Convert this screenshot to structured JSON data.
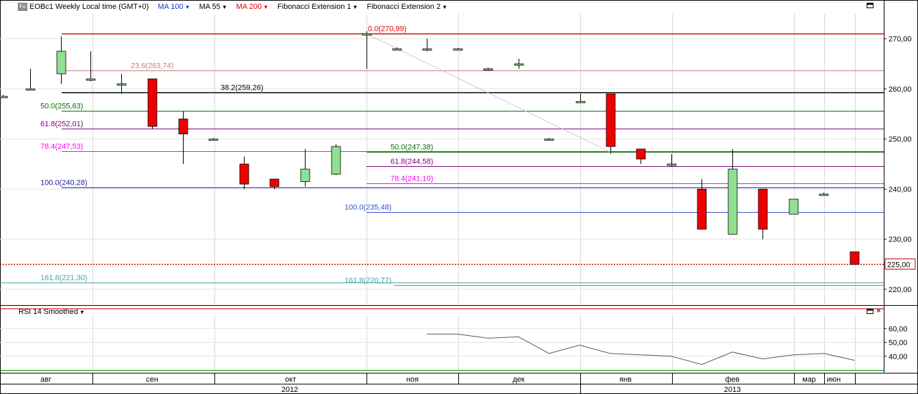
{
  "header": {
    "symbol_badge": "Fu",
    "symbol": "EOBc1 Weekly Local time (GMT+0)",
    "indicators": [
      {
        "label": "MA 100",
        "color": "#1e32c8"
      },
      {
        "label": "MA 55",
        "color": "#000000"
      },
      {
        "label": "MA 200",
        "color": "#e00000"
      },
      {
        "label": "Fibonacci Extension 1",
        "color": "#000000"
      },
      {
        "label": "Fibonacci Extension 2",
        "color": "#000000"
      }
    ]
  },
  "rsi_panel": {
    "title": "RSI 14 Smoothed"
  },
  "chart_data": [
    {
      "type": "candlestick",
      "ylim": [
        217,
        275
      ],
      "y_ticks": [
        "270,00",
        "260,00",
        "250,00",
        "240,00",
        "230,00",
        "220,00"
      ],
      "y_tick_values": [
        270,
        260,
        250,
        240,
        230,
        220
      ],
      "last_price_label": "225,00",
      "last_price": 225.0,
      "x_labels_months": [
        "авг",
        "сен",
        "окт",
        "ноя",
        "дек",
        "янв",
        "фев",
        "мар",
        "июн"
      ],
      "x_labels_years": [
        "2012",
        "2013"
      ],
      "candles": [
        {
          "o": 258.5,
          "h": 258.8,
          "l": 258.2,
          "c": 258.5
        },
        {
          "o": 260.0,
          "h": 264.0,
          "l": 259.8,
          "c": 260.0
        },
        {
          "o": 263.0,
          "h": 270.5,
          "l": 261.0,
          "c": 267.5
        },
        {
          "o": 262.0,
          "h": 267.5,
          "l": 261.5,
          "c": 262.0
        },
        {
          "o": 261.0,
          "h": 263.0,
          "l": 259.0,
          "c": 261.0
        },
        {
          "o": 262.0,
          "h": 262.0,
          "l": 252.0,
          "c": 252.5
        },
        {
          "o": 254.0,
          "h": 255.5,
          "l": 245.0,
          "c": 251.0
        },
        {
          "o": 250.0,
          "h": 250.2,
          "l": 249.8,
          "c": 250.0
        },
        {
          "o": 245.0,
          "h": 246.5,
          "l": 240.0,
          "c": 241.0
        },
        {
          "o": 242.0,
          "h": 242.0,
          "l": 240.0,
          "c": 240.5
        },
        {
          "o": 241.5,
          "h": 248.0,
          "l": 240.5,
          "c": 244.0
        },
        {
          "o": 243.0,
          "h": 249.0,
          "l": 242.8,
          "c": 248.5
        },
        {
          "o": 271.0,
          "h": 271.5,
          "l": 264.0,
          "c": 271.0
        },
        {
          "o": 268.0,
          "h": 268.3,
          "l": 267.8,
          "c": 268.0
        },
        {
          "o": 268.0,
          "h": 270.0,
          "l": 267.5,
          "c": 268.0
        },
        {
          "o": 268.0,
          "h": 268.2,
          "l": 267.8,
          "c": 268.0
        },
        {
          "o": 264.0,
          "h": 264.2,
          "l": 263.8,
          "c": 264.0
        },
        {
          "o": 265.0,
          "h": 266.0,
          "l": 264.0,
          "c": 265.0
        },
        {
          "o": 250.0,
          "h": 250.2,
          "l": 249.8,
          "c": 250.0
        },
        {
          "o": 257.5,
          "h": 259.0,
          "l": 257.2,
          "c": 257.5
        },
        {
          "o": 259.0,
          "h": 259.0,
          "l": 247.0,
          "c": 248.5
        },
        {
          "o": 248.0,
          "h": 248.0,
          "l": 245.0,
          "c": 246.0
        },
        {
          "o": 245.0,
          "h": 247.0,
          "l": 244.5,
          "c": 245.0
        },
        {
          "o": 240.0,
          "h": 242.0,
          "l": 232.0,
          "c": 232.0
        },
        {
          "o": 231.0,
          "h": 248.0,
          "l": 231.0,
          "c": 244.0
        },
        {
          "o": 240.0,
          "h": 240.0,
          "l": 230.0,
          "c": 232.0
        },
        {
          "o": 235.0,
          "h": 238.0,
          "l": 235.0,
          "c": 238.0
        },
        {
          "o": 239.0,
          "h": 239.3,
          "l": 238.7,
          "c": 239.0
        },
        {
          "o": 227.5,
          "h": 227.5,
          "l": 225.0,
          "c": 225.0
        }
      ],
      "fib_levels": [
        {
          "label": "0.0(270,99)",
          "value": 270.99,
          "color": "#e00000"
        },
        {
          "label": "23.6(263,74)",
          "value": 263.74,
          "color": "#c08080"
        },
        {
          "label": "38.2(259,26)",
          "value": 259.26,
          "color": "#000000"
        },
        {
          "label": "50.0(255,63)",
          "value": 255.63,
          "color": "#007000"
        },
        {
          "label": "61.8(252,01)",
          "value": 252.01,
          "color": "#800080"
        },
        {
          "label": "78.4(247,53)",
          "value": 247.53,
          "color": "#ff00ff"
        },
        {
          "label": "100.0(240,28)",
          "value": 240.28,
          "color": "#1e1ea0"
        },
        {
          "label": "161.8(221,30)",
          "value": 221.3,
          "color": "#4aa0a0"
        },
        {
          "label": "50.0(247,38)",
          "value": 247.38,
          "color": "#007000"
        },
        {
          "label": "61.8(244,58)",
          "value": 244.58,
          "color": "#800080"
        },
        {
          "label": "78.4(241,10)",
          "value": 241.1,
          "color": "#ff00ff"
        },
        {
          "label": "100.0(235,48)",
          "value": 235.48,
          "color": "#3050d0"
        },
        {
          "label": "161.8(220,77)",
          "value": 220.77,
          "color": "#4aa0a0"
        }
      ]
    },
    {
      "type": "line",
      "name": "RSI 14 Smoothed",
      "ylim": [
        30,
        70
      ],
      "y_ticks": [
        "60,00",
        "50,00",
        "40,00"
      ],
      "y_tick_values": [
        60,
        50,
        40
      ],
      "values": [
        56,
        56,
        53,
        54,
        42,
        48,
        42,
        41,
        40,
        34,
        43,
        38,
        41,
        42,
        37
      ]
    }
  ]
}
